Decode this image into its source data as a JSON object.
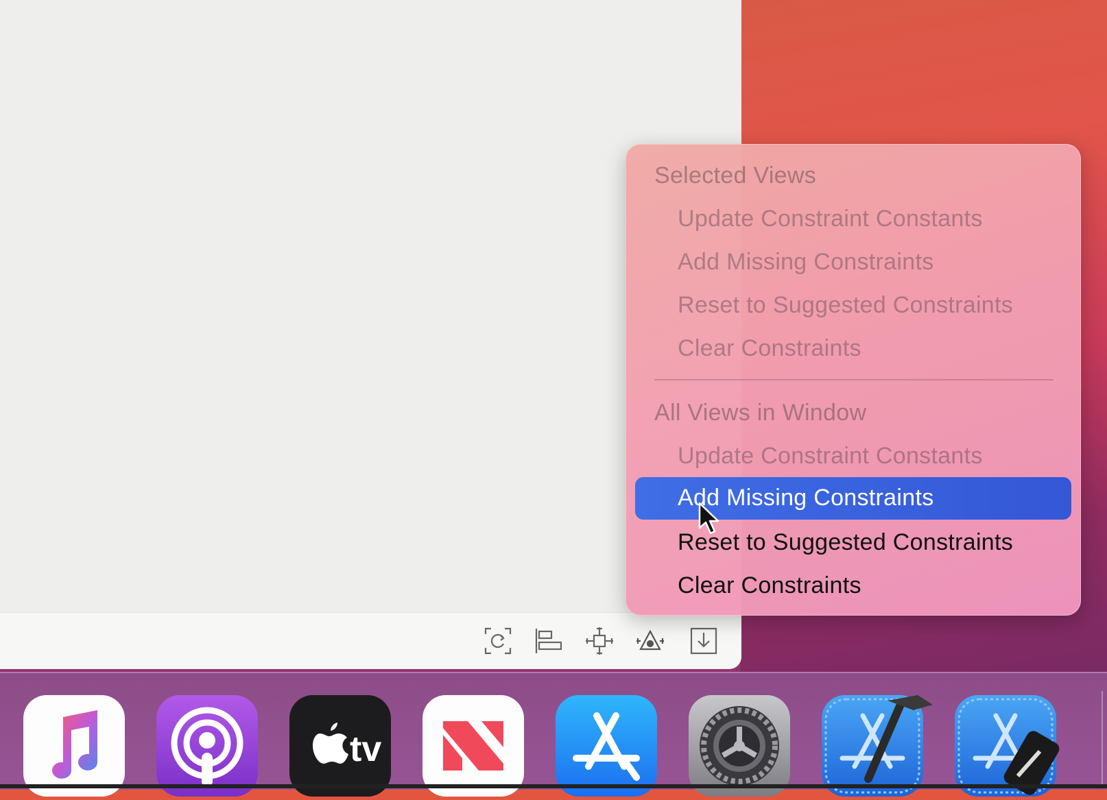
{
  "menu": {
    "sections": [
      {
        "header": "Selected Views",
        "items": [
          {
            "label": "Update Constraint Constants",
            "state": "disabled"
          },
          {
            "label": "Add Missing Constraints",
            "state": "disabled"
          },
          {
            "label": "Reset to Suggested Constraints",
            "state": "disabled"
          },
          {
            "label": "Clear Constraints",
            "state": "disabled"
          }
        ]
      },
      {
        "header": "All Views in Window",
        "items": [
          {
            "label": "Update Constraint Constants",
            "state": "disabled"
          },
          {
            "label": "Add Missing Constraints",
            "state": "highlighted"
          },
          {
            "label": "Reset to Suggested Constraints",
            "state": "enabled"
          },
          {
            "label": "Clear Constraints",
            "state": "enabled"
          }
        ]
      }
    ],
    "highlight_color": "#3a62e0"
  },
  "toolbar": {
    "icons": [
      "update-frames-icon",
      "align-icon",
      "add-constraints-icon",
      "resolve-auto-layout-icon",
      "embed-in-icon"
    ]
  },
  "dock": {
    "apps": [
      {
        "name": "Music",
        "icon": "music-note-icon"
      },
      {
        "name": "Podcasts",
        "icon": "podcasts-icon"
      },
      {
        "name": "TV",
        "icon": "apple-tv-icon",
        "text": "tv"
      },
      {
        "name": "News",
        "icon": "news-icon"
      },
      {
        "name": "App Store",
        "icon": "app-store-icon"
      },
      {
        "name": "System Preferences",
        "icon": "gear-icon"
      },
      {
        "name": "Xcode",
        "icon": "xcode-icon"
      },
      {
        "name": "Simulator",
        "icon": "simulator-icon"
      }
    ]
  }
}
